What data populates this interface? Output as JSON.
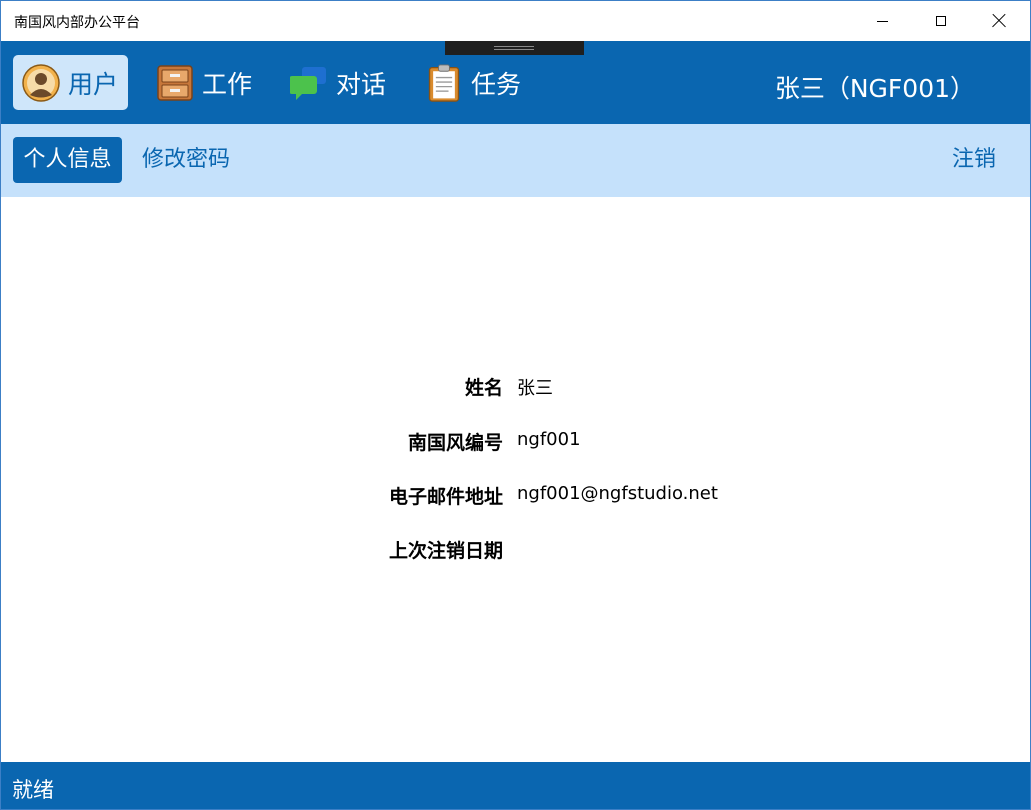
{
  "window": {
    "title": "南国风内部办公平台"
  },
  "nav": {
    "items": [
      {
        "label": "用户",
        "icon": "user-avatar-icon",
        "active": true
      },
      {
        "label": "工作",
        "icon": "cabinet-icon",
        "active": false
      },
      {
        "label": "对话",
        "icon": "chat-bubble-icon",
        "active": false
      },
      {
        "label": "任务",
        "icon": "clipboard-icon",
        "active": false
      }
    ],
    "current_user": "张三（NGF001）"
  },
  "subnav": {
    "items": [
      {
        "label": "个人信息",
        "active": true
      },
      {
        "label": "修改密码",
        "active": false
      }
    ],
    "logout": "注销"
  },
  "profile": {
    "fields": [
      {
        "label": "姓名",
        "value": "张三"
      },
      {
        "label": "南国风编号",
        "value": "ngf001"
      },
      {
        "label": "电子邮件地址",
        "value": "ngf001@ngfstudio.net"
      },
      {
        "label": "上次注销日期",
        "value": ""
      }
    ]
  },
  "status": {
    "text": "就绪"
  },
  "colors": {
    "primary": "#0a66b0",
    "subnav_bg": "#c5e1fb",
    "active_tab_bg": "#cfe6fa"
  }
}
